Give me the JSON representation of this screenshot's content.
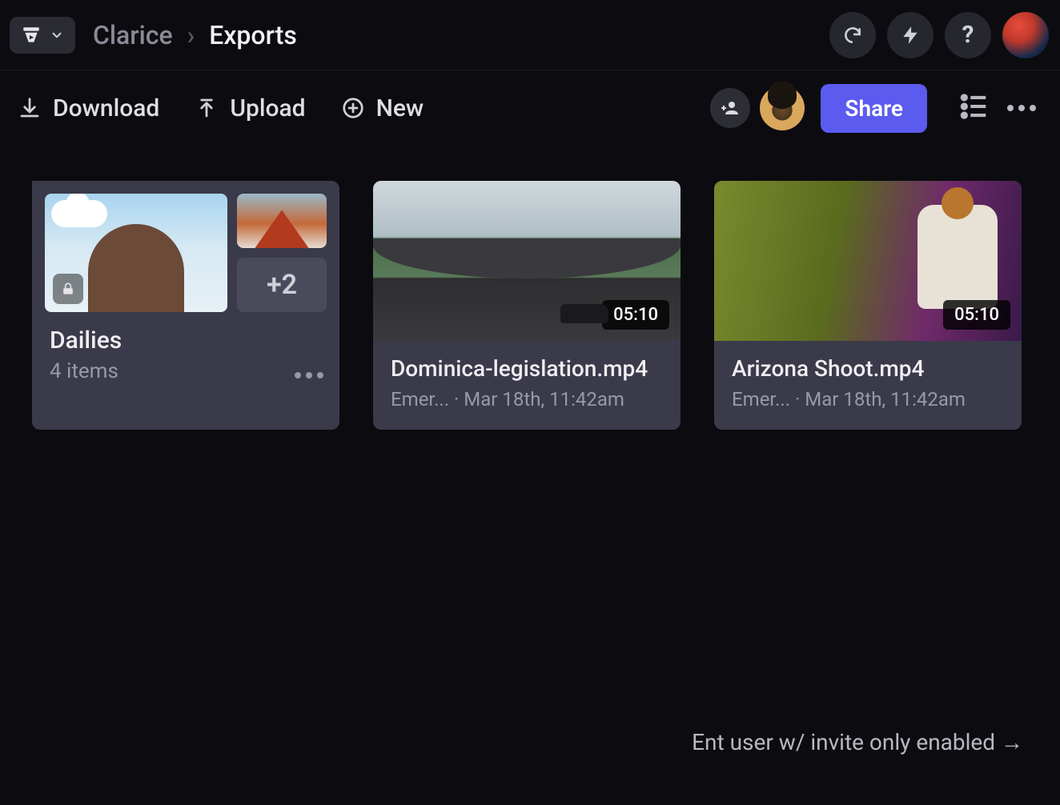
{
  "breadcrumbs": {
    "root": "Clarice",
    "leaf": "Exports"
  },
  "toolbar": {
    "download": "Download",
    "upload": "Upload",
    "new": "New",
    "share": "Share"
  },
  "folder": {
    "title": "Dailies",
    "subtitle": "4 items",
    "more_count": "+2"
  },
  "items": [
    {
      "title": "Dominica-legislation.mp4",
      "author": "Emer...",
      "timestamp": "Mar 18th, 11:42am",
      "duration": "05:10"
    },
    {
      "title": "Arizona Shoot.mp4",
      "author": "Emer...",
      "timestamp": "Mar 18th, 11:42am",
      "duration": "05:10"
    }
  ],
  "footer_note": "Ent user w/ invite only enabled →"
}
